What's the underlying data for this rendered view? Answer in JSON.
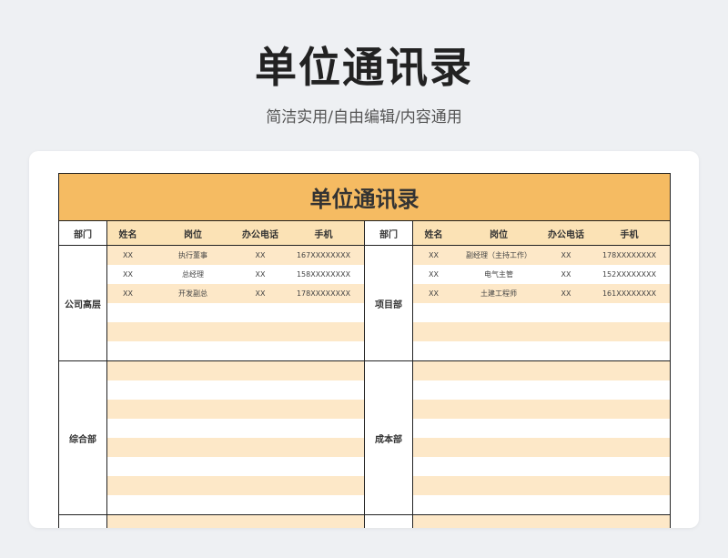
{
  "page": {
    "title": "单位通讯录",
    "subtitle": "简洁实用/自由编辑/内容通用"
  },
  "sheet": {
    "title": "单位通讯录",
    "headers": {
      "dept": "部门",
      "name": "姓名",
      "position": "岗位",
      "office_phone": "办公电话",
      "mobile": "手机"
    }
  },
  "left_groups": [
    {
      "dept": "公司高层",
      "rows": [
        {
          "name": "XX",
          "position": "执行董事",
          "office_phone": "XX",
          "mobile": "167XXXXXXXX"
        },
        {
          "name": "XX",
          "position": "总经理",
          "office_phone": "XX",
          "mobile": "158XXXXXXXX"
        },
        {
          "name": "XX",
          "position": "开发副总",
          "office_phone": "XX",
          "mobile": "178XXXXXXXX"
        },
        {
          "name": "",
          "position": "",
          "office_phone": "",
          "mobile": ""
        },
        {
          "name": "",
          "position": "",
          "office_phone": "",
          "mobile": ""
        },
        {
          "name": "",
          "position": "",
          "office_phone": "",
          "mobile": ""
        }
      ]
    },
    {
      "dept": "综合部",
      "rows": [
        {
          "name": "",
          "position": "",
          "office_phone": "",
          "mobile": ""
        },
        {
          "name": "",
          "position": "",
          "office_phone": "",
          "mobile": ""
        },
        {
          "name": "",
          "position": "",
          "office_phone": "",
          "mobile": ""
        },
        {
          "name": "",
          "position": "",
          "office_phone": "",
          "mobile": ""
        },
        {
          "name": "",
          "position": "",
          "office_phone": "",
          "mobile": ""
        },
        {
          "name": "",
          "position": "",
          "office_phone": "",
          "mobile": ""
        },
        {
          "name": "",
          "position": "",
          "office_phone": "",
          "mobile": ""
        },
        {
          "name": "",
          "position": "",
          "office_phone": "",
          "mobile": ""
        }
      ]
    },
    {
      "dept": "",
      "rows": [
        {
          "name": "",
          "position": "",
          "office_phone": "",
          "mobile": ""
        },
        {
          "name": "",
          "position": "",
          "office_phone": "",
          "mobile": ""
        }
      ]
    }
  ],
  "right_groups": [
    {
      "dept": "项目部",
      "rows": [
        {
          "name": "XX",
          "position": "副经理（主持工作）",
          "office_phone": "XX",
          "mobile": "178XXXXXXXX"
        },
        {
          "name": "XX",
          "position": "电气主管",
          "office_phone": "XX",
          "mobile": "152XXXXXXXX"
        },
        {
          "name": "XX",
          "position": "土建工程师",
          "office_phone": "XX",
          "mobile": "161XXXXXXXX"
        },
        {
          "name": "",
          "position": "",
          "office_phone": "",
          "mobile": ""
        },
        {
          "name": "",
          "position": "",
          "office_phone": "",
          "mobile": ""
        },
        {
          "name": "",
          "position": "",
          "office_phone": "",
          "mobile": ""
        }
      ]
    },
    {
      "dept": "成本部",
      "rows": [
        {
          "name": "",
          "position": "",
          "office_phone": "",
          "mobile": ""
        },
        {
          "name": "",
          "position": "",
          "office_phone": "",
          "mobile": ""
        },
        {
          "name": "",
          "position": "",
          "office_phone": "",
          "mobile": ""
        },
        {
          "name": "",
          "position": "",
          "office_phone": "",
          "mobile": ""
        },
        {
          "name": "",
          "position": "",
          "office_phone": "",
          "mobile": ""
        },
        {
          "name": "",
          "position": "",
          "office_phone": "",
          "mobile": ""
        },
        {
          "name": "",
          "position": "",
          "office_phone": "",
          "mobile": ""
        },
        {
          "name": "",
          "position": "",
          "office_phone": "",
          "mobile": ""
        }
      ]
    },
    {
      "dept": "",
      "rows": [
        {
          "name": "",
          "position": "",
          "office_phone": "",
          "mobile": ""
        },
        {
          "name": "",
          "position": "",
          "office_phone": "",
          "mobile": ""
        }
      ]
    }
  ]
}
